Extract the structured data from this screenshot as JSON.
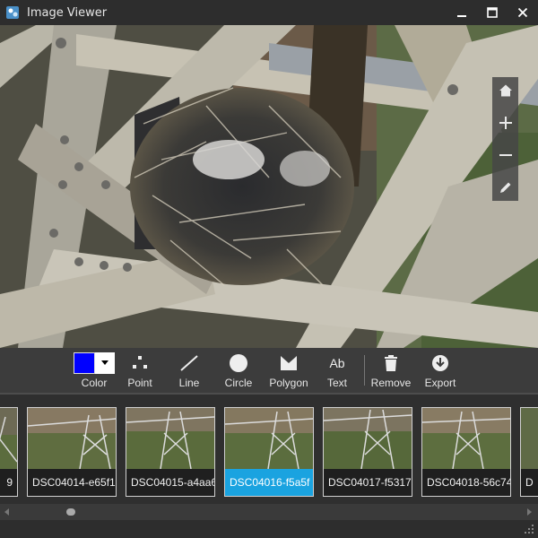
{
  "window": {
    "title": "Image Viewer"
  },
  "icons": {
    "app": "app-icon",
    "minimize": "minimize-icon",
    "maximize": "maximize-icon",
    "close": "close-icon",
    "home": "home-icon",
    "zoom_in": "plus-icon",
    "zoom_out": "minus-icon",
    "pencil": "pencil-icon"
  },
  "toolbar": {
    "color_label": "Color",
    "selected_color": "#0000ff",
    "tools": [
      {
        "id": "point",
        "label": "Point"
      },
      {
        "id": "line",
        "label": "Line"
      },
      {
        "id": "circle",
        "label": "Circle"
      },
      {
        "id": "polygon",
        "label": "Polygon"
      },
      {
        "id": "text",
        "label": "Text",
        "glyph": "Ab"
      },
      {
        "id": "remove",
        "label": "Remove"
      },
      {
        "id": "export",
        "label": "Export"
      }
    ]
  },
  "thumbnails": [
    {
      "label": "9"
    },
    {
      "label": "DSC04014-e65f1"
    },
    {
      "label": "DSC04015-a4aa6"
    },
    {
      "label": "DSC04016-f5a5f",
      "selected": true
    },
    {
      "label": "DSC04017-f5317"
    },
    {
      "label": "DSC04018-56c74"
    },
    {
      "label": "D"
    }
  ],
  "colors": {
    "accent": "#1aa3e0",
    "background": "#2b2b2b",
    "toolbar": "#3c3c3c"
  }
}
